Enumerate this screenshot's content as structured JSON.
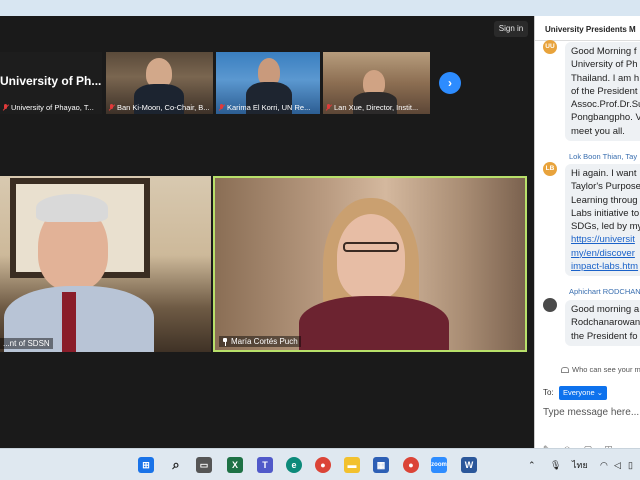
{
  "window": {
    "signin_label": "Sign in"
  },
  "thumbnails": [
    {
      "big_name": "University of Ph...",
      "label": "University of Phayao, T..."
    },
    {
      "label": "Ban Ki-Moon, Co-Chair, B..."
    },
    {
      "label": "Karima El Korri, UN Re..."
    },
    {
      "label": "Lan Xue, Director, Instit..."
    }
  ],
  "next_icon": "chevron-right-icon",
  "videos": [
    {
      "label": "...nt of SDSN"
    },
    {
      "label": "María Cortés Puch"
    }
  ],
  "chat": {
    "title": "University Presidents M",
    "messages": [
      {
        "initials": "UU",
        "avatar_color": "#e8a33c",
        "lines": [
          "Good Morning f",
          "University of Ph",
          "Thailand. I am h",
          "of the President",
          "Assoc.Prof.Dr.Su",
          "Pongbangpho. V",
          "meet you all."
        ]
      },
      {
        "sender": "Lok Boon Thian, Tay",
        "initials": "LB",
        "avatar_color": "#e8a33c",
        "lines": [
          "Hi again. I want",
          "Taylor's Purpose",
          "Learning throug",
          "Labs initiative to",
          "SDGs, led by my"
        ],
        "link_lines": [
          "https://universit",
          "my/en/discover",
          "impact-labs.htm"
        ]
      },
      {
        "sender": "Aphichart RODCHAN",
        "lines": [
          "Good morning a",
          "Rodchanarowan",
          "the President fo"
        ]
      }
    ],
    "who_can_see": "Who can see your m",
    "to_label": "To:",
    "to_value": "Everyone",
    "input_placeholder": "Type message here..."
  },
  "taskbar": {
    "lang": "ไทย",
    "colors": {
      "windows": "#1a73e8",
      "zoom": "#2d8cff",
      "word": "#2b579a",
      "excel": "#1e7145",
      "teams": "#5059c9",
      "chrome": "#db4437",
      "edge": "#0c8a7a",
      "folder": "#f2c12e",
      "store": "#2d5fb5"
    }
  }
}
